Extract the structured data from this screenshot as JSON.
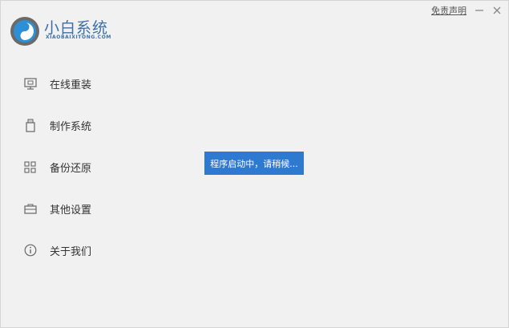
{
  "brand": {
    "name": "小白系统",
    "subtitle": "XIAOBAIXITONG.COM",
    "logo_icon": "xiaobai-logo-icon",
    "accent_color": "#3b6fa8"
  },
  "titlebar": {
    "disclaimer_label": "免责声明",
    "minimize_icon": "minimize-icon",
    "close_icon": "close-icon"
  },
  "sidebar": {
    "items": [
      {
        "label": "在线重装",
        "icon": "monitor-icon"
      },
      {
        "label": "制作系统",
        "icon": "usb-drive-icon"
      },
      {
        "label": "备份还原",
        "icon": "grid-icon"
      },
      {
        "label": "其他设置",
        "icon": "briefcase-icon"
      },
      {
        "label": "关于我们",
        "icon": "info-icon"
      }
    ]
  },
  "toast": {
    "message": "程序启动中，请稍候...",
    "background_color": "#2f7ad1"
  }
}
